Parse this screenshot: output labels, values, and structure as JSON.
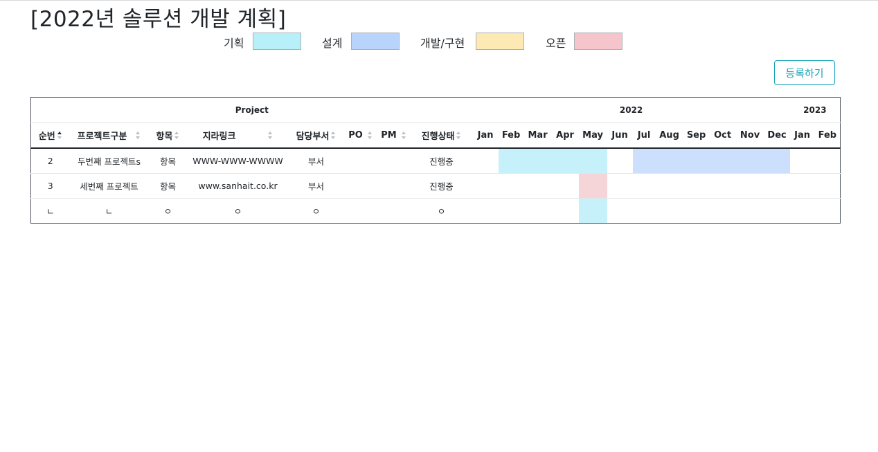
{
  "page": {
    "title": "[2022년 솔루션 개발 계획]"
  },
  "legend": {
    "items": [
      {
        "label": "기획",
        "color": "#b8f0fa"
      },
      {
        "label": "설계",
        "color": "#b8d4fc"
      },
      {
        "label": "개발/구현",
        "color": "#fde9b4"
      },
      {
        "label": "오픈",
        "color": "#f5c5cb"
      }
    ]
  },
  "toolbar": {
    "register_label": "등록하기"
  },
  "table": {
    "group_headers": {
      "project": "Project",
      "year_2022": "2022",
      "year_2023": "2023"
    },
    "columns": [
      "순번",
      "프로젝트구분",
      "항목",
      "지라링크",
      "담당부서",
      "PO",
      "PM",
      "진행상태"
    ],
    "months": [
      "Jan",
      "Feb",
      "Mar",
      "Apr",
      "May",
      "Jun",
      "Jul",
      "Aug",
      "Sep",
      "Oct",
      "Nov",
      "Dec",
      "Jan",
      "Feb"
    ],
    "rows": [
      {
        "cells": [
          "2",
          "두번째 프로젝트s",
          "항목",
          "WWW-WWW-WWWW",
          "부서",
          "",
          "",
          "진행중"
        ],
        "timeline": [
          null,
          "#c6f1fb",
          "#c6f1fb",
          "#c6f1fb",
          "#c6f1fb",
          null,
          "#ccdffc",
          "#ccdffc",
          "#ccdffc",
          "#ccdffc",
          "#ccdffc",
          "#ccdffc",
          null,
          null
        ]
      },
      {
        "cells": [
          "3",
          "세번째 프로젝트",
          "항목",
          "www.sanhait.co.kr",
          "부서",
          "",
          "",
          "진행중"
        ],
        "timeline": [
          null,
          null,
          null,
          null,
          "#f6d5d9",
          null,
          null,
          null,
          null,
          null,
          null,
          null,
          null,
          null
        ]
      },
      {
        "cells": [
          "ㄴ",
          "ㄴ",
          "ㅇ",
          "ㅇ",
          "ㅇ",
          "",
          "",
          "ㅇ"
        ],
        "timeline": [
          null,
          null,
          null,
          null,
          "#c6f1fb",
          null,
          null,
          null,
          null,
          null,
          null,
          null,
          null,
          null
        ]
      }
    ]
  }
}
